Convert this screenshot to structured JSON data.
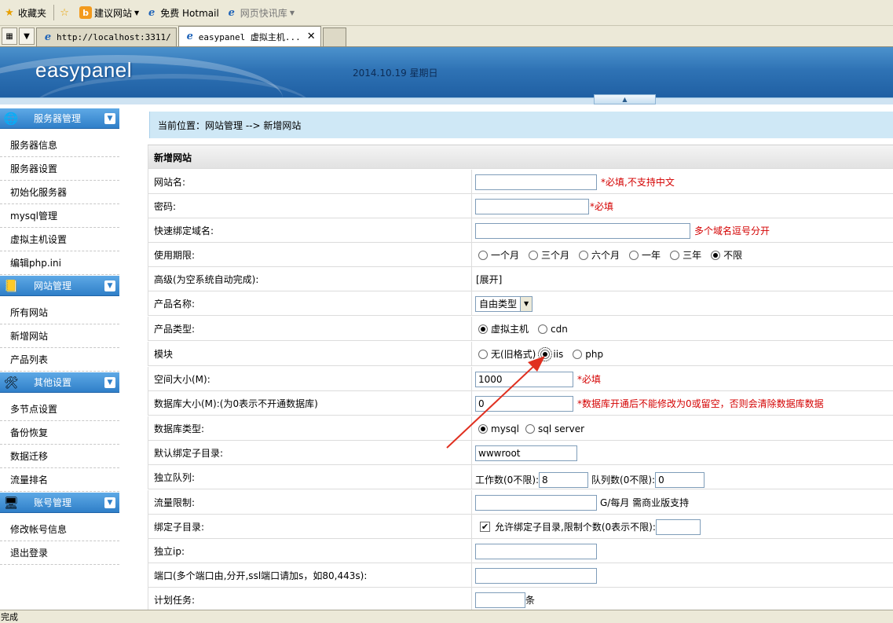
{
  "browser": {
    "favorites": {
      "fav_label": "收藏夹",
      "suggested": "建议网站",
      "hotmail": "免费 Hotmail",
      "webslice": "网页快讯库"
    },
    "tabs": [
      {
        "label": "http://localhost:3311/"
      },
      {
        "label": "easypanel 虚拟主机..."
      }
    ],
    "status": "完成"
  },
  "header": {
    "logo": "easypanel",
    "date": "2014.10.19 星期日"
  },
  "sidebar": {
    "sections": [
      {
        "title": "服务器管理",
        "items": [
          "服务器信息",
          "服务器设置",
          "初始化服务器",
          "mysql管理",
          "虚拟主机设置",
          "编辑php.ini"
        ]
      },
      {
        "title": "网站管理",
        "items": [
          "所有网站",
          "新增网站",
          "产品列表"
        ]
      },
      {
        "title": "其他设置",
        "items": [
          "多节点设置",
          "备份恢复",
          "数据迁移",
          "流量排名"
        ]
      },
      {
        "title": "账号管理",
        "items": [
          "修改帐号信息",
          "退出登录"
        ]
      }
    ]
  },
  "main": {
    "location": "当前位置：网站管理 --> 新增网站",
    "form_title": "新增网站",
    "rows": {
      "site_name": {
        "label": "网站名:",
        "value": "",
        "hint": "*必填,不支持中文"
      },
      "password": {
        "label": "密码:",
        "value": "",
        "hint": "*必填"
      },
      "domain": {
        "label": "快速绑定域名:",
        "value": "",
        "hint": "多个域名逗号分开"
      },
      "period": {
        "label": "使用期限:",
        "options": [
          "一个月",
          "三个月",
          "六个月",
          "一年",
          "三年",
          "不限"
        ],
        "selected": "不限"
      },
      "advanced": {
        "label": "高级(为空系统自动完成):",
        "link": "[展开]"
      },
      "product_name": {
        "label": "产品名称:",
        "selected": "自由类型"
      },
      "product_type": {
        "label": "产品类型:",
        "options": [
          "虚拟主机",
          "cdn"
        ],
        "selected": "虚拟主机"
      },
      "module": {
        "label": "模块",
        "options": [
          "无(旧格式)",
          "iis",
          "php"
        ],
        "selected": "iis"
      },
      "space": {
        "label": "空间大小(M):",
        "value": "1000",
        "hint": "*必填"
      },
      "db_size": {
        "label": "数据库大小(M):(为0表示不开通数据库)",
        "value": "0",
        "hint": "*数据库开通后不能修改为0或留空，否则会清除数据库数据"
      },
      "db_type": {
        "label": "数据库类型:",
        "options": [
          "mysql",
          "sql server"
        ],
        "selected": "mysql"
      },
      "subdir": {
        "label": "默认绑定子目录:",
        "value": "wwwroot"
      },
      "queue": {
        "label": "独立队列:",
        "workers_label": "工作数(0不限):",
        "workers": "8",
        "queue_label": "队列数(0不限):",
        "queue": "0"
      },
      "traffic": {
        "label": "流量限制:",
        "value": "",
        "hint": "G/每月 需商业版支持"
      },
      "bind_subdir": {
        "label": "绑定子目录:",
        "checkbox_label": "允许绑定子目录,限制个数(0表示不限):",
        "checked": true,
        "value": ""
      },
      "ip": {
        "label": "独立ip:",
        "value": ""
      },
      "port": {
        "label": "端口(多个端口由,分开,ssl端口请加s，如80,443s):",
        "value": ""
      },
      "cron": {
        "label": "计划任务:",
        "value": "",
        "unit": "条"
      }
    }
  },
  "colors": {
    "arrow": "#e03020",
    "header": "#2f73b5",
    "required": "#d40000"
  }
}
